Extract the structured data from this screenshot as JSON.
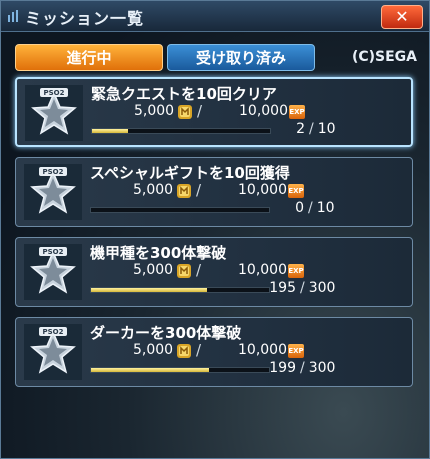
{
  "window": {
    "title": "ミッション一覧",
    "close_label": "✕"
  },
  "tabs": [
    {
      "label": "進行中",
      "active": true
    },
    {
      "label": "受け取り済み",
      "active": false
    }
  ],
  "copyright": "(C)SEGA",
  "missions": [
    {
      "title": "緊急クエストを10回クリア",
      "meseta": "5,000",
      "exp": "10,000",
      "current": "2",
      "total": "10",
      "progress": 0.2,
      "selected": true
    },
    {
      "title": "スペシャルギフトを10回獲得",
      "meseta": "5,000",
      "exp": "10,000",
      "current": "0",
      "total": "10",
      "progress": 0.0,
      "selected": false
    },
    {
      "title": "機甲種を300体撃破",
      "meseta": "5,000",
      "exp": "10,000",
      "current": "195",
      "total": "300",
      "progress": 0.65,
      "selected": false
    },
    {
      "title": "ダーカーを300体撃破",
      "meseta": "5,000",
      "exp": "10,000",
      "current": "199",
      "total": "300",
      "progress": 0.663,
      "selected": false
    }
  ],
  "icons": {
    "meseta": "meseta-icon",
    "exp": "exp-icon",
    "badge": "star-badge-icon"
  },
  "exp_label": "EXP",
  "badge_text": "PSO2",
  "colors": {
    "tab_active": "#f09020",
    "tab_inactive": "#2a76bc",
    "close": "#e04820",
    "progress_fill": "#e6cc5a"
  }
}
